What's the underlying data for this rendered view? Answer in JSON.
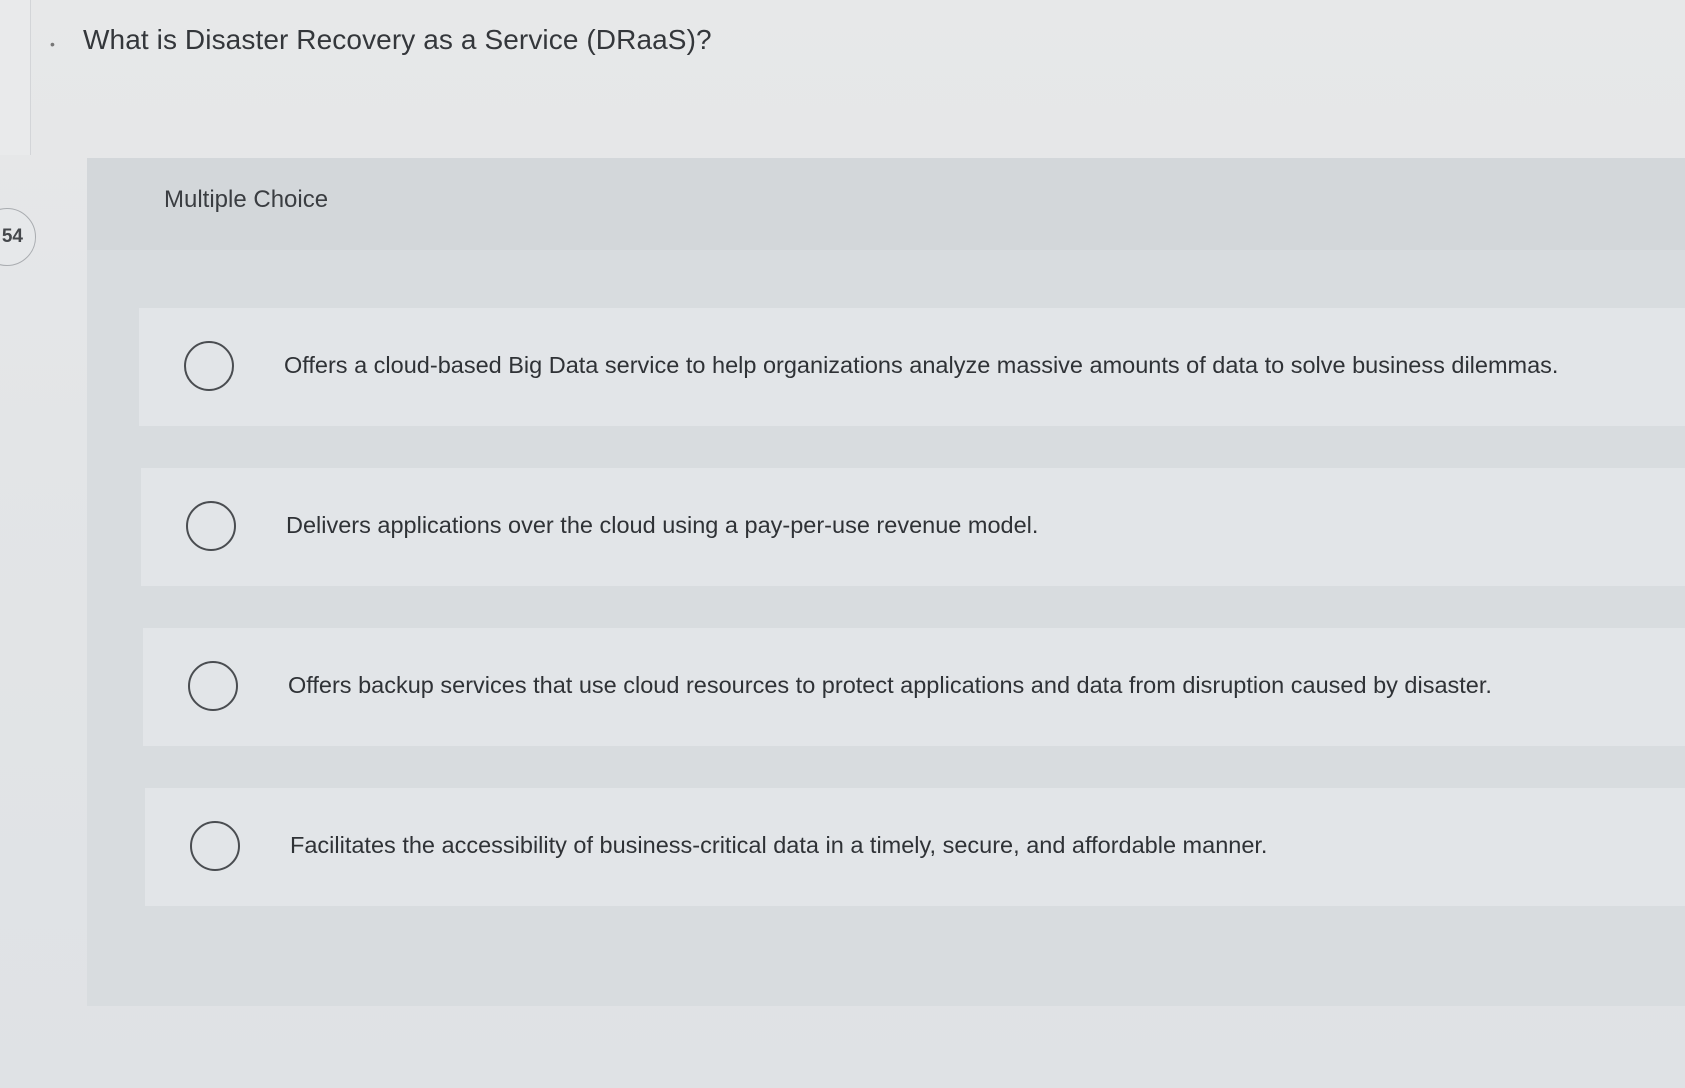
{
  "question": {
    "number": "54",
    "text": "What is Disaster Recovery as a Service (DRaaS)?",
    "type": "Multiple Choice"
  },
  "options": [
    {
      "label": "Offers a cloud-based Big Data service to help organizations analyze massive amounts of data to solve business dilemmas.",
      "selected": false
    },
    {
      "label": "Delivers applications over the cloud using a pay-per-use revenue model.",
      "selected": false
    },
    {
      "label": "Offers backup services that use cloud resources to protect applications and data from disruption caused by disaster.",
      "selected": false
    },
    {
      "label": "Facilitates the accessibility of business-critical data in a timely, secure, and affordable manner.",
      "selected": false
    }
  ]
}
